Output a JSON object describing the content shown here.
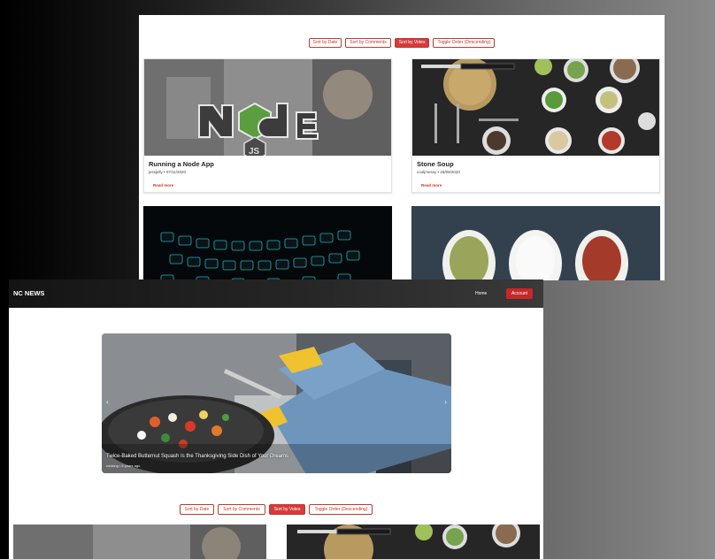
{
  "back": {
    "sort_buttons": [
      "Sort by Date",
      "Sort by Comments",
      "Sort by Votes",
      "Toggle Order (Descending)"
    ],
    "articles": [
      {
        "title": "Running a Node App",
        "author": "jessjelly",
        "date": "07/11/2020",
        "read_more": "Read more"
      },
      {
        "title": "Stone Soup",
        "author": "cooljmessy",
        "date": "26/08/2020",
        "read_more": "Read more"
      }
    ]
  },
  "navbar": {
    "brand": "NC NEWS",
    "home": "Home",
    "account": "Account"
  },
  "hero": {
    "caption": "Twice-Baked Butternut Squash Is the Thanksgiving Side Dish of Your Dreams",
    "meta": "cooking • 5 years ago"
  },
  "front": {
    "sort_buttons": [
      "Sort by Date",
      "Sort by Comments",
      "Sort by Votes",
      "Toggle Order (Descending)"
    ]
  },
  "colors": {
    "accent": "#c62828",
    "active_sort": "#d63a3a",
    "navbar": "#1f1f1f"
  }
}
